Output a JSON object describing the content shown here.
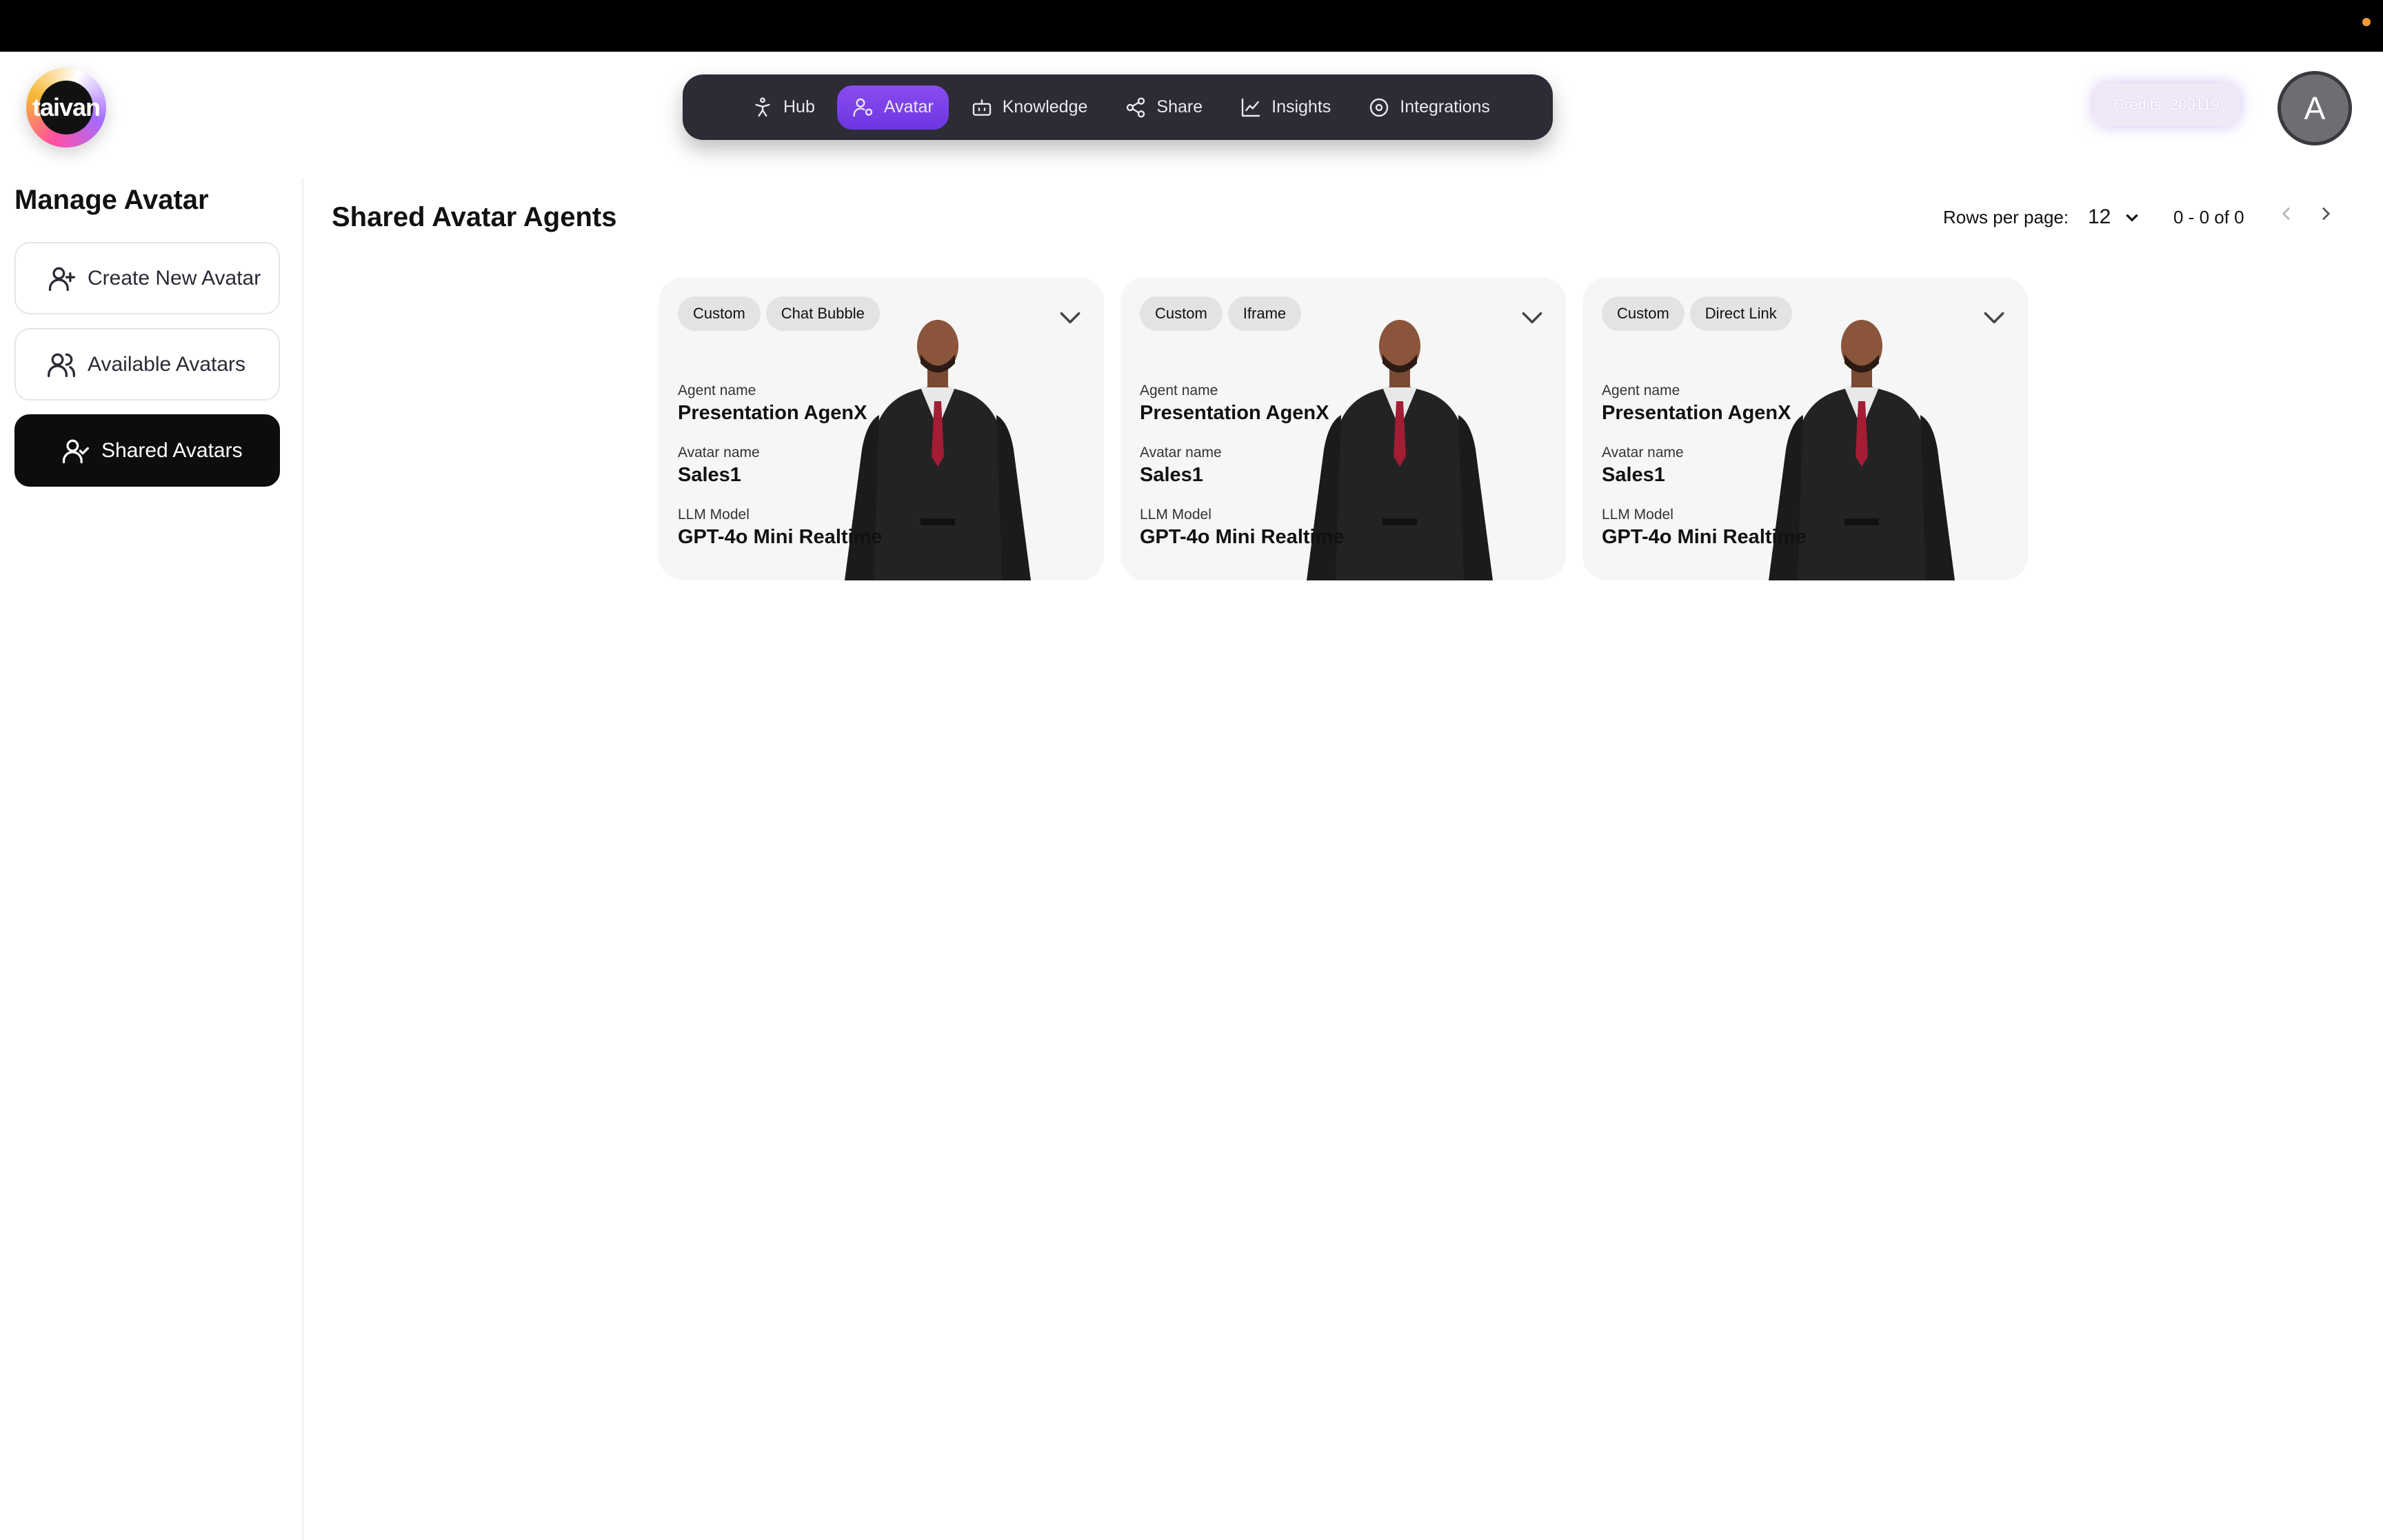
{
  "header": {
    "logo_text": "taivan",
    "nav": [
      {
        "label": "Hub",
        "icon": "person-hub-icon"
      },
      {
        "label": "Avatar",
        "icon": "user-settings-icon",
        "active": true
      },
      {
        "label": "Knowledge",
        "icon": "bot-icon"
      },
      {
        "label": "Share",
        "icon": "share-icon"
      },
      {
        "label": "Insights",
        "icon": "line-chart-icon"
      },
      {
        "label": "Integrations",
        "icon": "integration-icon"
      }
    ],
    "credits": "Credits: 200119",
    "user_initial": "A"
  },
  "sidebar": {
    "title": "Manage Avatar",
    "items": [
      {
        "label": "Create New Avatar",
        "icon": "user-plus-icon"
      },
      {
        "label": "Available Avatars",
        "icon": "users-icon"
      },
      {
        "label": "Shared Avatars",
        "icon": "user-check-icon",
        "active": true
      }
    ]
  },
  "main": {
    "title": "Shared Avatar Agents",
    "pagination": {
      "rows_label": "Rows per page:",
      "rows_value": "12",
      "range": "0 - 0 of 0"
    },
    "cards": [
      {
        "tags": [
          "Custom",
          "Chat Bubble"
        ],
        "agent_label": "Agent name",
        "agent_name": "Presentation AgenX",
        "avatar_label": "Avatar name",
        "avatar_name": "Sales1",
        "llm_label": "LLM Model",
        "llm_model": "GPT-4o Mini Realtime"
      },
      {
        "tags": [
          "Custom",
          "Iframe"
        ],
        "agent_label": "Agent name",
        "agent_name": "Presentation AgenX",
        "avatar_label": "Avatar name",
        "avatar_name": "Sales1",
        "llm_label": "LLM Model",
        "llm_model": "GPT-4o Mini Realtime"
      },
      {
        "tags": [
          "Custom",
          "Direct Link"
        ],
        "agent_label": "Agent name",
        "agent_name": "Presentation AgenX",
        "avatar_label": "Avatar name",
        "avatar_name": "Sales1",
        "llm_label": "LLM Model",
        "llm_model": "GPT-4o Mini Realtime"
      }
    ]
  },
  "colors": {
    "nav_bg": "#2c2b36",
    "nav_active": "#7c3aed",
    "sidebar_active": "#0d0d0d",
    "card_bg": "#f6f6f6",
    "notification_dot": "#f39c3a"
  }
}
